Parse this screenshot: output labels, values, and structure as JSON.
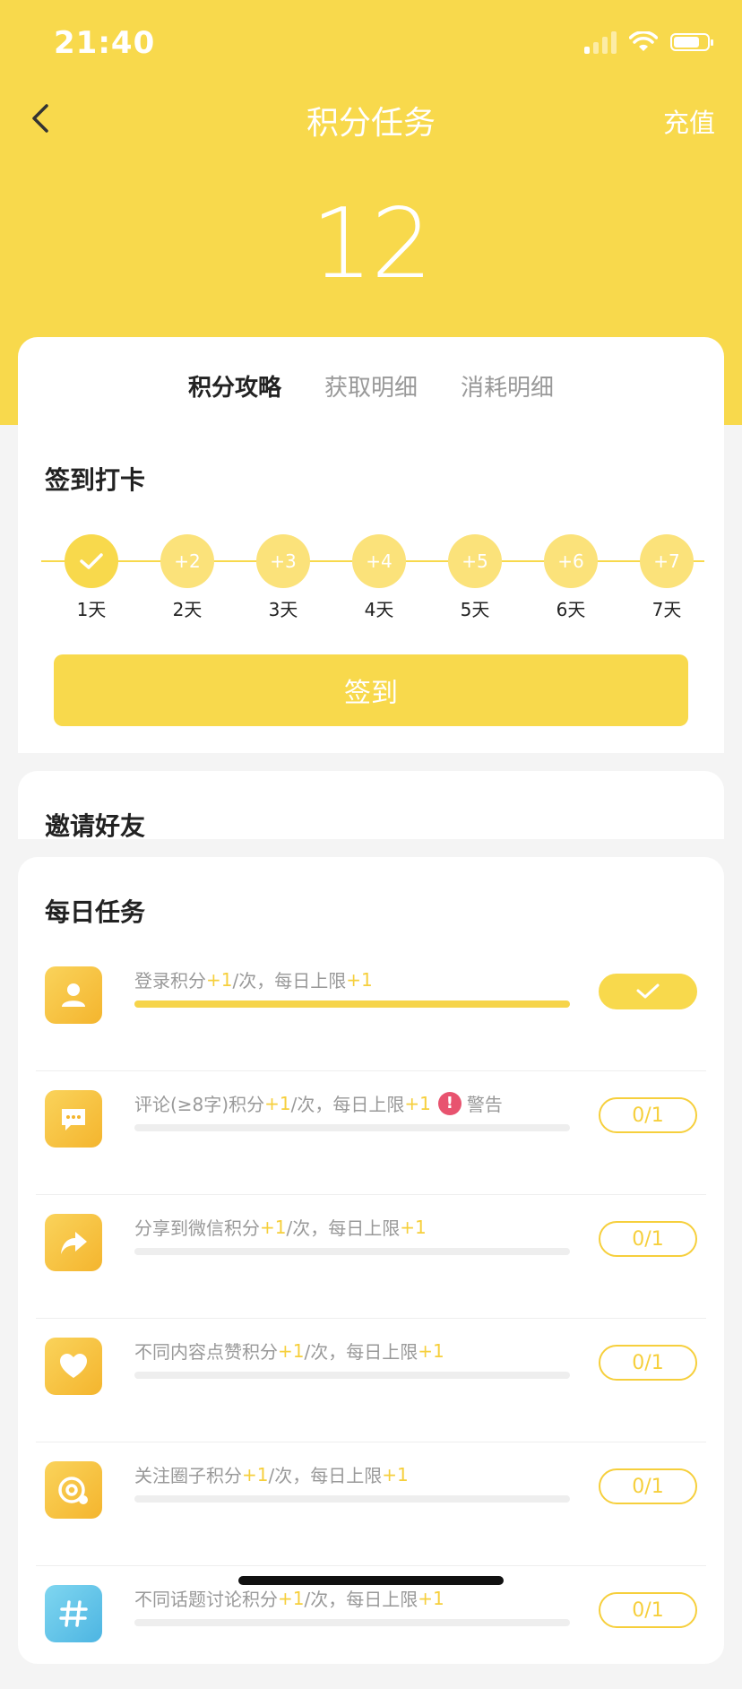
{
  "status_bar": {
    "time": "21:40"
  },
  "nav": {
    "title": "积分任务",
    "recharge": "充值"
  },
  "points": "12",
  "tabs": [
    {
      "label": "积分攻略",
      "active": true
    },
    {
      "label": "获取明细",
      "active": false
    },
    {
      "label": "消耗明细",
      "active": false
    }
  ],
  "checkin": {
    "title": "签到打卡",
    "days": [
      {
        "bonus": "",
        "label": "1天",
        "done": true
      },
      {
        "bonus": "+2",
        "label": "2天",
        "done": false
      },
      {
        "bonus": "+3",
        "label": "3天",
        "done": false
      },
      {
        "bonus": "+4",
        "label": "4天",
        "done": false
      },
      {
        "bonus": "+5",
        "label": "5天",
        "done": false
      },
      {
        "bonus": "+6",
        "label": "6天",
        "done": false
      },
      {
        "bonus": "+7",
        "label": "7天",
        "done": false
      }
    ],
    "button": "签到"
  },
  "invite": {
    "title": "邀请好友"
  },
  "daily": {
    "title": "每日任务",
    "tasks": [
      {
        "icon": "user-icon",
        "prefix": "登录积分",
        "plus": "+1",
        "mid": "/次，每日上限",
        "limit": "+1",
        "warning": "",
        "progress": 1.0,
        "status": "",
        "done": true
      },
      {
        "icon": "comment-icon",
        "prefix": "评论(≥8字)积分",
        "plus": "+1",
        "mid": "/次，每日上限",
        "limit": "+1",
        "warning": "警告",
        "progress": 0,
        "status": "0/1",
        "done": false
      },
      {
        "icon": "share-icon",
        "prefix": "分享到微信积分",
        "plus": "+1",
        "mid": "/次，每日上限",
        "limit": "+1",
        "warning": "",
        "progress": 0,
        "status": "0/1",
        "done": false
      },
      {
        "icon": "heart-icon",
        "prefix": "不同内容点赞积分",
        "plus": "+1",
        "mid": "/次，每日上限",
        "limit": "+1",
        "warning": "",
        "progress": 0,
        "status": "0/1",
        "done": false
      },
      {
        "icon": "circle-follow-icon",
        "prefix": "关注圈子积分",
        "plus": "+1",
        "mid": "/次，每日上限",
        "limit": "+1",
        "warning": "",
        "progress": 0,
        "status": "0/1",
        "done": false
      },
      {
        "icon": "hashtag-icon",
        "prefix": "不同话题讨论积分",
        "plus": "+1",
        "mid": "/次，每日上限",
        "limit": "+1",
        "warning": "",
        "progress": 0,
        "status": "0/1",
        "done": false
      }
    ]
  },
  "colors": {
    "accent": "#f8d94c",
    "warning": "#e8536f"
  }
}
